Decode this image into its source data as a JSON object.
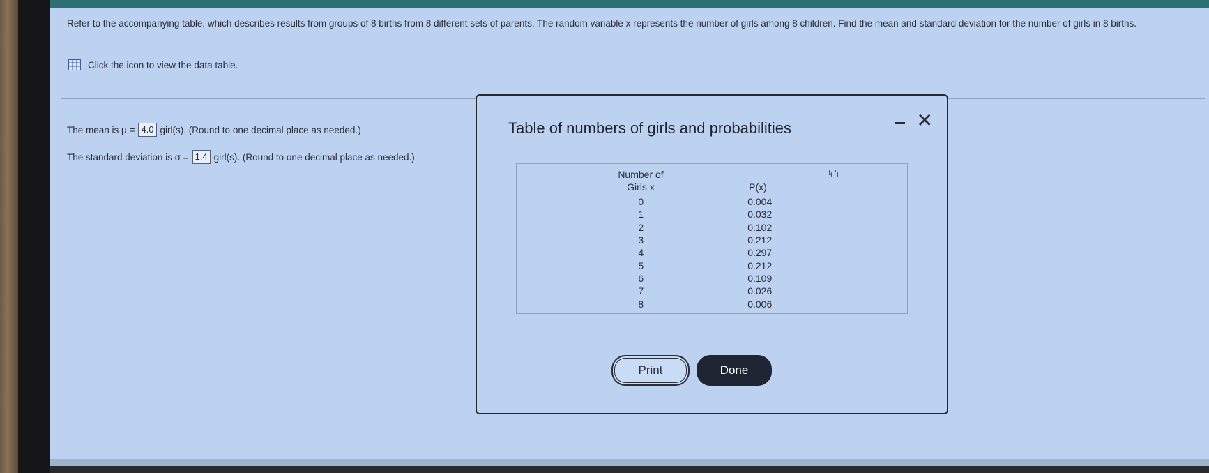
{
  "question": {
    "text": "Refer to the accompanying table, which describes results from groups of 8 births from 8 different sets of parents. The random variable x represents the number of girls among 8 children. Find the mean and standard deviation for the number of girls in 8 births.",
    "data_link": "Click the icon to view the data table."
  },
  "answers": {
    "mean_prefix": "The mean is μ =",
    "mean_value": "4.0",
    "mean_suffix": "girl(s). (Round to one decimal place as needed.)",
    "sd_prefix": "The standard deviation is σ =",
    "sd_value": "1.4",
    "sd_suffix": "girl(s). (Round to one decimal place as needed.)"
  },
  "modal": {
    "title": "Table of numbers of girls and probabilities",
    "close_glyph": "✕",
    "table": {
      "col1_header_line1": "Number of",
      "col1_header_line2": "Girls x",
      "col2_header": "P(x)",
      "rows": [
        {
          "x": "0",
          "p": "0.004"
        },
        {
          "x": "1",
          "p": "0.032"
        },
        {
          "x": "2",
          "p": "0.102"
        },
        {
          "x": "3",
          "p": "0.212"
        },
        {
          "x": "4",
          "p": "0.297"
        },
        {
          "x": "5",
          "p": "0.212"
        },
        {
          "x": "6",
          "p": "0.109"
        },
        {
          "x": "7",
          "p": "0.026"
        },
        {
          "x": "8",
          "p": "0.006"
        }
      ]
    },
    "print_label": "Print",
    "done_label": "Done"
  },
  "colors": {
    "screen_background": "#bcd2f0",
    "top_bar": "#2d6f73",
    "done_button": "#1f2533",
    "data_icon": "#3d5d9a"
  }
}
